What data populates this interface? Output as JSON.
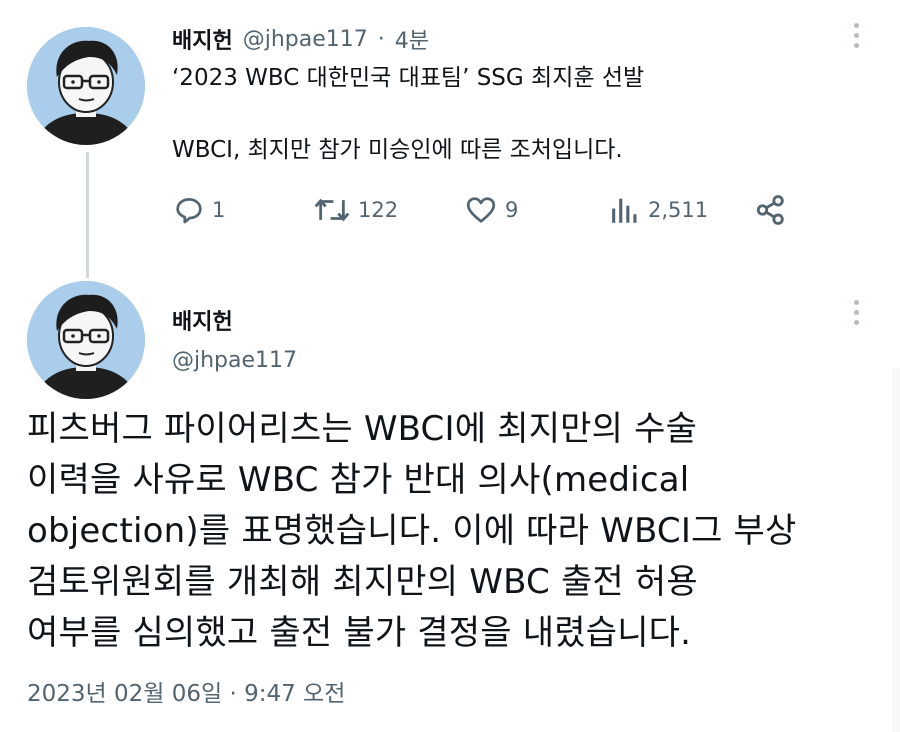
{
  "tweet1": {
    "author_name": "배지헌",
    "handle": "@jhpae117",
    "separator": "·",
    "time": "4분",
    "line1": "‘2023 WBC 대한민국 대표팀’ SSG 최지훈 선발",
    "line2": "WBCI, 최지만 참가 미승인에 따른 조처입니다.",
    "actions": {
      "reply_count": "1",
      "retweet_count": "122",
      "like_count": "9",
      "views_count": "2,511"
    }
  },
  "tweet2": {
    "author_name": "배지헌",
    "handle": "@jhpae117",
    "body_lines": [
      "피츠버그 파이어리츠는 WBCI에 최지만의 수술",
      "이력을 사유로 WBC 참가 반대 의사(medical",
      "objection)를 표명했습니다. 이에 따라 WBCI그 부상",
      "검토위원회를 개최해 최지만의 WBC 출전 허용",
      "여부를 심의했고 출전 불가 결정을 내렸습니다."
    ],
    "timestamp": "2023년 02월 06일 · 9:47 오전"
  },
  "icons": {
    "reply": "reply-icon",
    "retweet": "retweet-icon",
    "like": "heart-icon",
    "views": "views-icon",
    "share": "share-icon",
    "more": "more-icon"
  },
  "colors": {
    "avatar_bg": "#a9cdea",
    "text": "#0f1419",
    "muted": "#536471",
    "thread_line": "#cfd9de"
  }
}
